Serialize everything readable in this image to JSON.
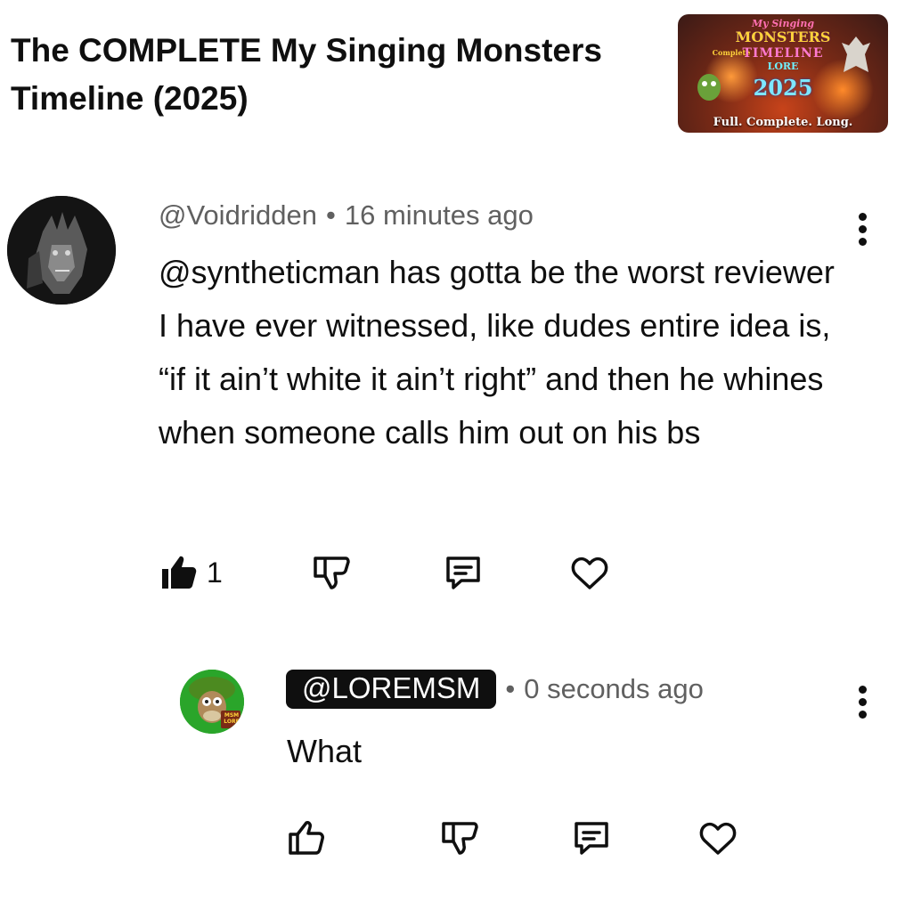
{
  "video": {
    "title": "The COMPLETE My Singing Monsters Timeline (2025)",
    "thumbnail": {
      "logo_top": "My Singing",
      "logo_main": "MONSTERS",
      "logo_complete": "Complete",
      "logo_timeline": "TIMELINE",
      "logo_lore": "LORE",
      "logo_year": "2025",
      "caption": "Full. Complete. Long."
    }
  },
  "comment": {
    "author": "@Voidridden",
    "separator": "•",
    "time": "16 minutes ago",
    "text": "@syntheticman has gotta be the worst reviewer I have ever witnessed, like dudes entire idea is, “if it ain’t white it ain’t right” and then he whines when someone calls him out on his bs",
    "likes": "1",
    "like_state": "liked",
    "icons": [
      "thumbs-up-icon",
      "thumbs-down-icon",
      "reply-icon",
      "heart-icon",
      "more-vert-icon"
    ]
  },
  "reply": {
    "author": "@LOREMSM",
    "author_badge": "creator",
    "avatar_text": "MSM LORE",
    "separator": "•",
    "time": "0 seconds ago",
    "text": "What",
    "icons": [
      "thumbs-up-icon",
      "thumbs-down-icon",
      "reply-icon",
      "heart-icon",
      "more-vert-icon"
    ]
  },
  "colors": {
    "text_primary": "#0f0f0f",
    "text_secondary": "#606060",
    "badge_bg": "#0f0f0f",
    "background": "#ffffff",
    "reply_avatar_green": "#2aa52a"
  }
}
